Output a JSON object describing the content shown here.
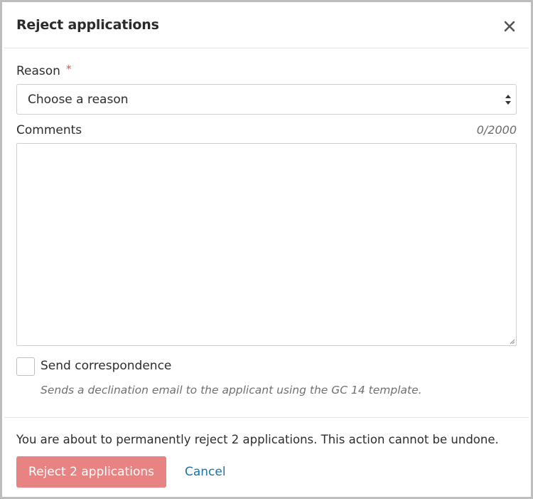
{
  "modal": {
    "title": "Reject applications",
    "close_icon": "close-icon"
  },
  "form": {
    "reason": {
      "label": "Reason",
      "required_marker": "*",
      "selected": "Choose a reason"
    },
    "comments": {
      "label": "Comments",
      "counter": "0/2000",
      "value": ""
    },
    "correspondence": {
      "label": "Send correspondence",
      "checked": false,
      "hint": "Sends a declination email to the applicant using the GC 14 template."
    }
  },
  "footer": {
    "warning": "You are about to permanently reject 2 applications. This action cannot be undone.",
    "reject_label": "Reject 2 applications",
    "cancel_label": "Cancel"
  },
  "colors": {
    "reject_button": "#e88384",
    "cancel_link": "#1a73a8",
    "required": "#d9534f"
  }
}
